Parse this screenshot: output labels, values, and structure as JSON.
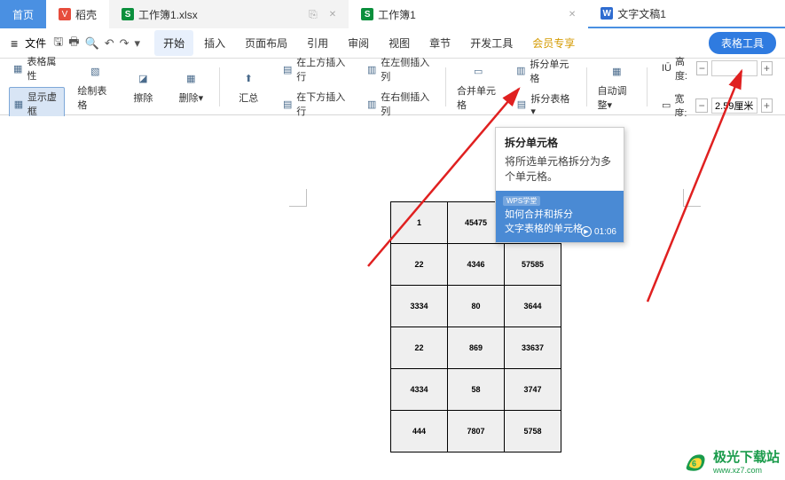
{
  "tabs": {
    "home": "首页",
    "docao": "稻壳",
    "xlsx1": "工作簿1.xlsx",
    "xlsx2": "工作簿1",
    "wz": "文字文稿1"
  },
  "menubar": {
    "file": "文件",
    "items": [
      "开始",
      "插入",
      "页面布局",
      "引用",
      "审阅",
      "视图",
      "章节",
      "开发工具",
      "会员专享"
    ],
    "tool": "表格工具"
  },
  "ribbon": {
    "tableProps": "表格属性",
    "showFrame": "显示虚框",
    "drawTable": "绘制表格",
    "erase": "擦除",
    "delete": "删除",
    "deleteDrop": "▾",
    "summary": "汇总",
    "insertAbove": "在上方插入行",
    "insertBelow": "在下方插入行",
    "insertLeft": "在左侧插入列",
    "insertRight": "在右侧插入列",
    "mergeCell": "合并单元格",
    "splitCell": "拆分单元格",
    "splitTable": "拆分表格",
    "splitTableDrop": "▾",
    "autoAdjust": "自动调整",
    "autoAdjustDrop": "▾",
    "height": "高度:",
    "width": "宽度:",
    "heightVal": "",
    "widthVal": "2.59厘米",
    "hIcon": "IŪ",
    "wIcon": "▭"
  },
  "table": {
    "rows": [
      [
        "1",
        "45475",
        ""
      ],
      [
        "22",
        "4346",
        "57585"
      ],
      [
        "3334",
        "80",
        "3644"
      ],
      [
        "22",
        "869",
        "33637"
      ],
      [
        "4334",
        "58",
        "3747"
      ],
      [
        "444",
        "7807",
        "5758"
      ]
    ]
  },
  "tooltip": {
    "title": "拆分单元格",
    "desc": "将所选单元格拆分为多个单元格。",
    "badge": "WPS学堂",
    "video1": "如何合并和拆分",
    "video2": "文字表格的单元格",
    "time": "01:06"
  },
  "watermark": {
    "name": "极光下载站",
    "url": "www.xz7.com"
  }
}
